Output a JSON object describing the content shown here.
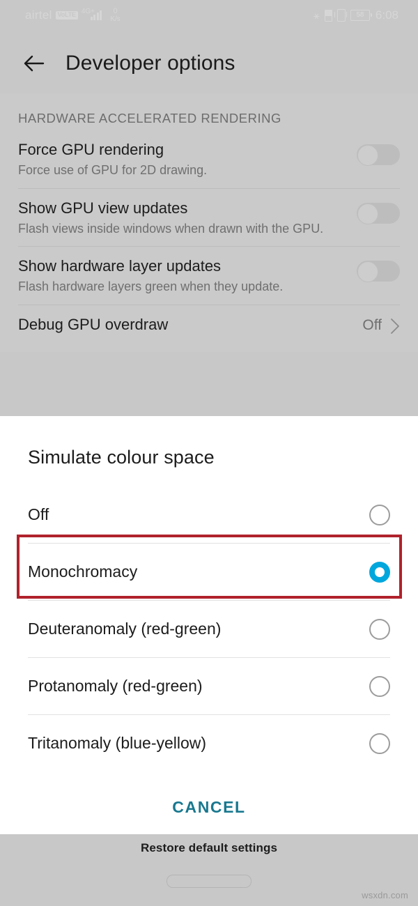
{
  "status_bar": {
    "carrier": "airtel",
    "volte_badge": "VoLTE",
    "network_type": "4G+",
    "data_rate_value": "0",
    "data_rate_unit": "K/s",
    "battery_percent": "58",
    "time": "6:08"
  },
  "action_bar": {
    "title": "Developer options",
    "back_icon": "arrow-left-icon"
  },
  "settings": {
    "section_header": "HARDWARE ACCELERATED RENDERING",
    "rows": [
      {
        "title": "Force GPU rendering",
        "subtitle": "Force use of GPU for 2D drawing.",
        "control": "toggle",
        "checked": false
      },
      {
        "title": "Show GPU view updates",
        "subtitle": "Flash views inside windows when drawn with the GPU.",
        "control": "toggle",
        "checked": false
      },
      {
        "title": "Show hardware layer updates",
        "subtitle": "Flash hardware layers green when they update.",
        "control": "toggle",
        "checked": false
      },
      {
        "title": "Debug GPU overdraw",
        "subtitle": "",
        "control": "value",
        "value": "Off",
        "chevron_icon": "chevron-right-icon"
      }
    ]
  },
  "dialog": {
    "title": "Simulate colour space",
    "options": [
      {
        "label": "Off",
        "selected": false
      },
      {
        "label": "Monochromacy",
        "selected": true
      },
      {
        "label": "Deuteranomaly (red-green)",
        "selected": false
      },
      {
        "label": "Protanomaly (red-green)",
        "selected": false
      },
      {
        "label": "Tritanomaly (blue-yellow)",
        "selected": false
      }
    ],
    "cancel_label": "CANCEL",
    "accent_color": "#00a7dd",
    "cancel_color": "#19788f"
  },
  "annotation": {
    "color": "#b0222c",
    "target_option": "Monochromacy"
  },
  "bottom": {
    "restore_label": "Restore default settings",
    "home_indicator": "home-pill",
    "watermark": "wsxdn.com"
  }
}
